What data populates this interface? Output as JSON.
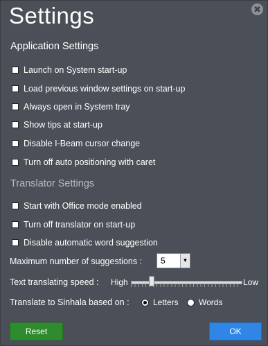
{
  "window": {
    "title": "Settings",
    "close_glyph": "✖"
  },
  "application_settings": {
    "heading": "Application Settings",
    "options": [
      {
        "label": "Launch on System start-up",
        "checked": false
      },
      {
        "label": "Load previous window settings on start-up",
        "checked": false
      },
      {
        "label": "Always open in System tray",
        "checked": false
      },
      {
        "label": "Show tips at start-up",
        "checked": false
      },
      {
        "label": "Disable I-Beam cursor change",
        "checked": false
      },
      {
        "label": "Turn off auto positioning with caret",
        "checked": false
      }
    ]
  },
  "translator_settings": {
    "heading": "Translator Settings",
    "options": [
      {
        "label": "Start with Office mode enabled",
        "checked": false
      },
      {
        "label": "Turn off translator on start-up",
        "checked": false
      },
      {
        "label": "Disable automatic word suggestion",
        "checked": false
      }
    ],
    "max_suggestions": {
      "label": "Maximum number of suggestions :",
      "value": "5",
      "arrow": "▼"
    },
    "speed": {
      "label": "Text translating speed :",
      "high_label": "High",
      "low_label": "Low",
      "position_fraction": 0.17
    },
    "translate_to": {
      "label": "Translate to Sinhala based on :",
      "options": [
        {
          "label": "Letters",
          "selected": true
        },
        {
          "label": "Words",
          "selected": false
        }
      ]
    }
  },
  "buttons": {
    "reset": "Reset",
    "ok": "OK"
  },
  "colors": {
    "background": "#4b4f57",
    "reset": "#2e8b2e",
    "ok": "#2f86e6",
    "section_dim": "#b8bcc2"
  }
}
